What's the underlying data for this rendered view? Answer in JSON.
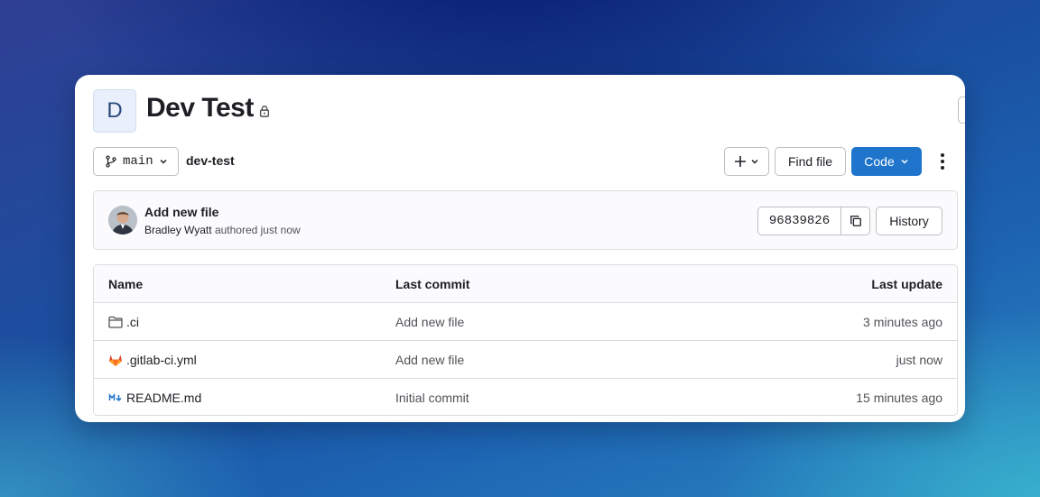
{
  "project": {
    "avatar_letter": "D",
    "title": "Dev Test"
  },
  "toolbar": {
    "branch": "main",
    "breadcrumb": "dev-test",
    "find_file": "Find file",
    "code": "Code"
  },
  "last_commit": {
    "title": "Add new file",
    "author": "Bradley Wyatt",
    "authored_text": "authored just now",
    "sha": "96839826",
    "history": "History"
  },
  "table": {
    "headers": {
      "name": "Name",
      "last_commit": "Last commit",
      "last_update": "Last update"
    },
    "rows": [
      {
        "icon": "folder-icon",
        "name": ".ci",
        "last_commit": "Add new file",
        "last_update": "3 minutes ago"
      },
      {
        "icon": "gitlab-icon",
        "name": ".gitlab-ci.yml",
        "last_commit": "Add new file",
        "last_update": "just now"
      },
      {
        "icon": "markdown-icon",
        "name": "README.md",
        "last_commit": "Initial commit",
        "last_update": "15 minutes ago"
      }
    ]
  },
  "colors": {
    "accent": "#1f75cb",
    "gitlab_orange": "#e24329"
  }
}
